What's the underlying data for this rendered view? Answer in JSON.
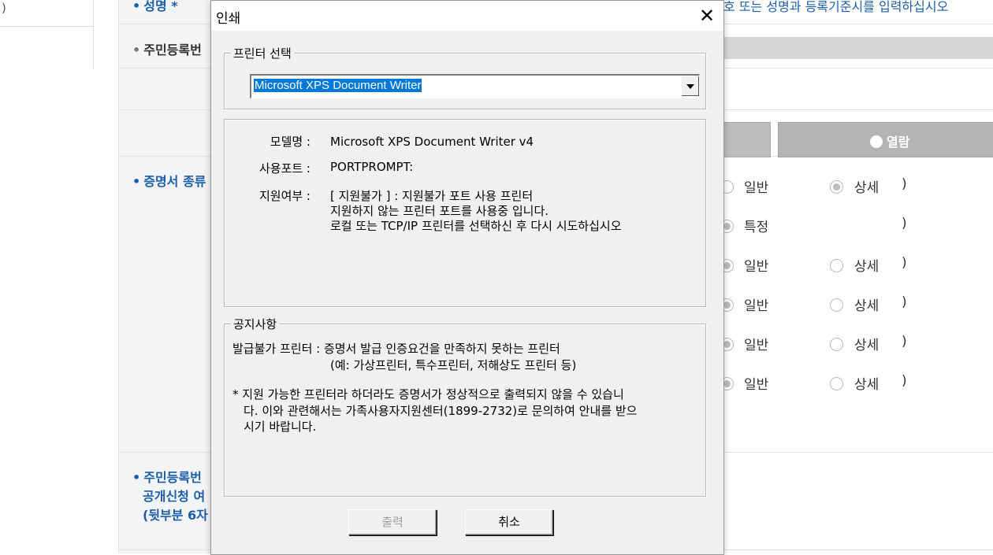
{
  "background": {
    "left_paren": ")",
    "labels": {
      "name": "성명 *",
      "resident_number": "주민등록번",
      "cert_type": "증명서 종류",
      "public_req_1": "주민등록번",
      "public_req_2": "공개신청 여",
      "public_req_3": "(뒷부분 6자"
    },
    "top_hint": "호 또는 성명과 등록기준시를 입력하십시오",
    "tab_right_label": "열람",
    "radio_rows": [
      {
        "a": "일반",
        "b": "상세",
        "close": ")"
      },
      {
        "a": "특정",
        "b": "",
        "close": ")"
      },
      {
        "a": "일반",
        "b": "상세",
        "close": ")"
      },
      {
        "a": "일반",
        "b": "상세",
        "close": ")"
      },
      {
        "a": "일반",
        "b": "상세",
        "close": ")"
      },
      {
        "a": "일반",
        "b": "상세",
        "close": ")"
      }
    ]
  },
  "dialog": {
    "title": "인쇄",
    "printer_group_label": "프린터 선택",
    "selected_printer": "Microsoft XPS Document Writer",
    "model_label": "모델명 :",
    "model_value": "Microsoft XPS Document Writer v4",
    "port_label": "사용포트 :",
    "port_value": "PORTPROMPT:",
    "support_label": "지원여부 :",
    "support_lines": [
      "[ 지원불가 ] : 지원불가 포트 사용 프린터",
      "지원하지 않는 프린터 포트를 사용중 입니다.",
      "로컬 또는 TCP/IP 프린터를 선택하신 후 다시 시도하십시오"
    ],
    "notice_group_label": "공지사항",
    "notice_lines": [
      "발급불가 프린터 : 증명서 발급 인증요건을 만족하지 못하는 프린터",
      "(예: 가상프린터, 특수프린터, 저해상도 프린터 등)",
      "* 지원 가능한 프린터라 하더라도 증명서가 정상적으로 출력되지 않을 수 있습니",
      "다. 이와 관련해서는 가족사용자지원센터(1899-2732)로 문의하여 안내를 받으",
      "시기 바랍니다."
    ],
    "print_button": "출력",
    "cancel_button": "취소"
  }
}
